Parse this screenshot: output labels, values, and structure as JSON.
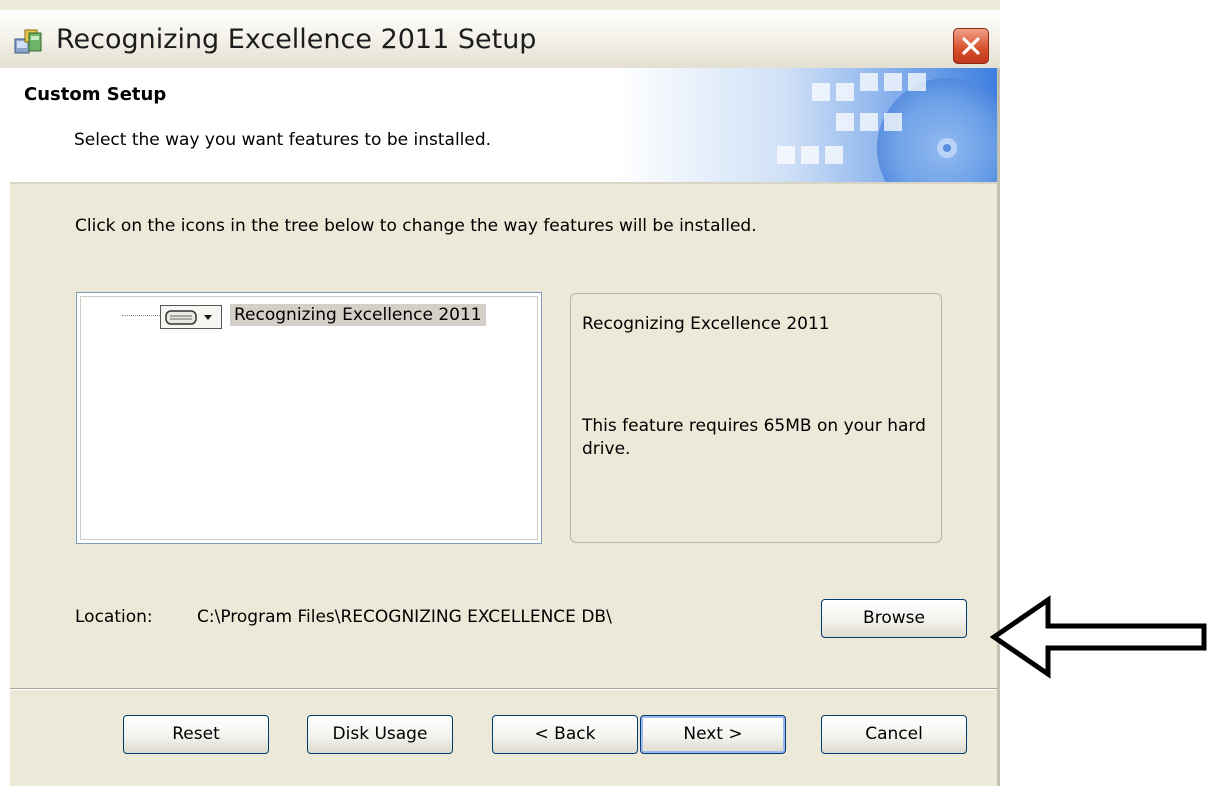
{
  "window": {
    "title": "Recognizing Excellence 2011 Setup"
  },
  "banner": {
    "title": "Custom Setup",
    "subtitle": "Select the way you want features to be installed."
  },
  "instruction": "Click on the icons in the tree below to change the way features will be installed.",
  "tree": {
    "items": [
      {
        "label": "Recognizing Excellence 2011",
        "icon": "drive-icon"
      }
    ]
  },
  "description": {
    "title": "Recognizing Excellence 2011",
    "text": "This feature requires 65MB on your hard drive."
  },
  "location": {
    "label": "Location:",
    "path": "C:\\Program Files\\RECOGNIZING EXCELLENCE DB\\"
  },
  "buttons": {
    "browse": "Browse",
    "reset": "Reset",
    "disk_usage": "Disk Usage",
    "back": "< Back",
    "next": "Next >",
    "cancel": "Cancel"
  },
  "colors": {
    "dialog_bg": "#ece9d8",
    "button_border": "#003c74",
    "close_button": "#d9542f"
  }
}
